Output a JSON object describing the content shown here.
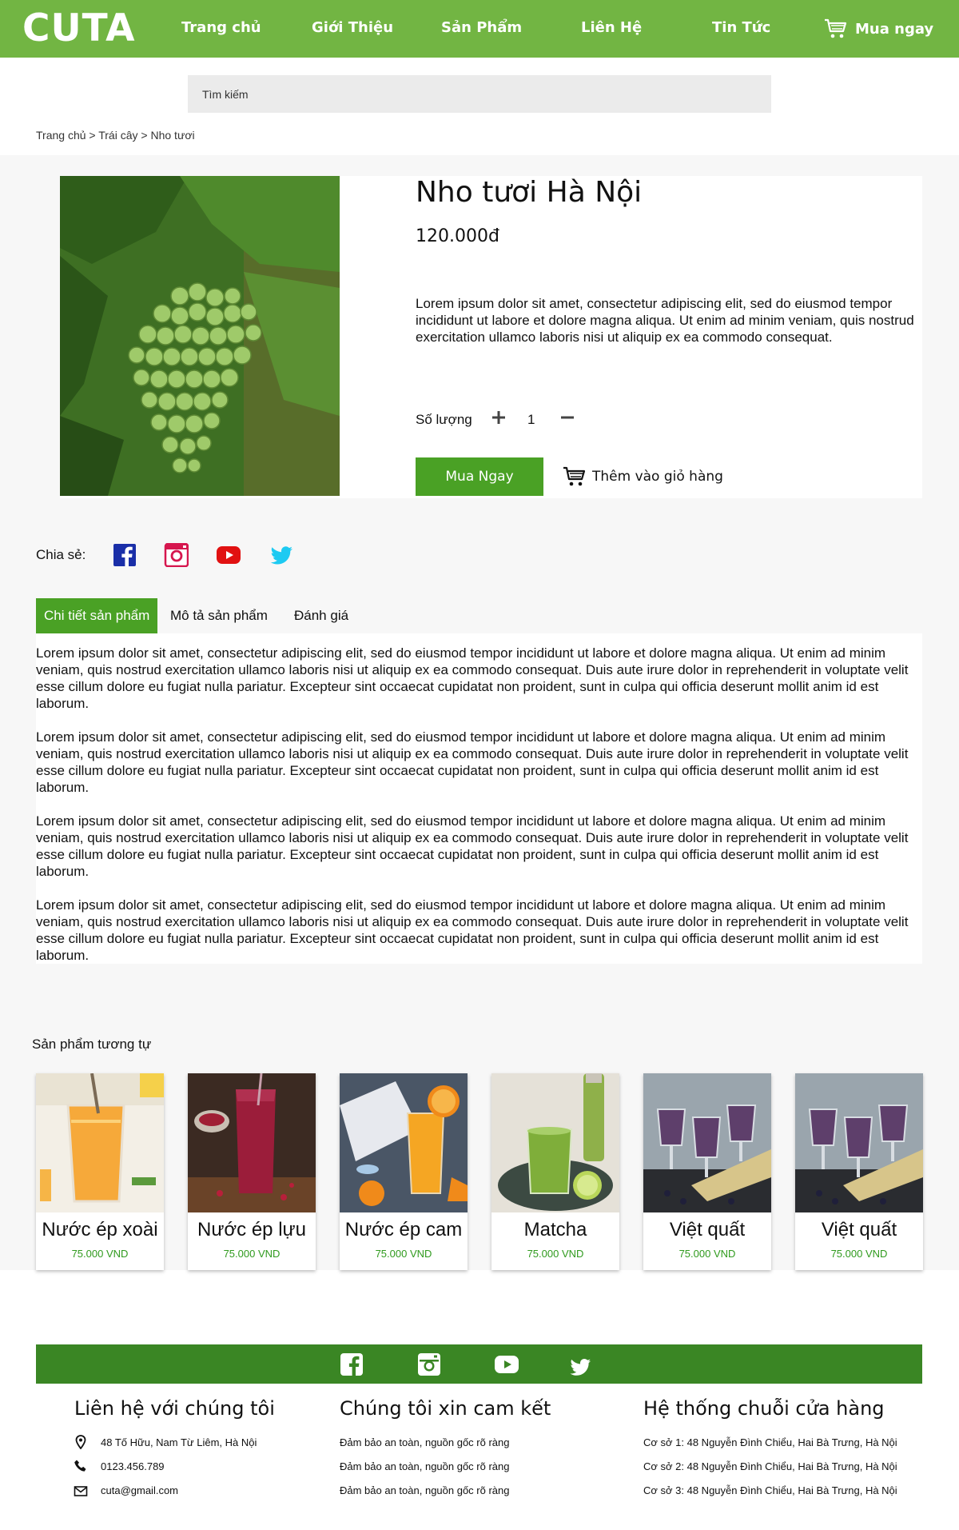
{
  "brand": {
    "logo": "CUTA",
    "primary_color": "#72b543",
    "button_color": "#4aa125",
    "footer_color": "#3a8624",
    "price_color": "#2f9a1d"
  },
  "nav": {
    "items": [
      "Trang chủ",
      "Giới Thiệu",
      "Sản Phẩm",
      "Liên Hệ",
      "Tin Tức"
    ],
    "cart_label": "Mua ngay",
    "cart_icon": "cart-icon"
  },
  "search": {
    "placeholder": "Tìm kiếm"
  },
  "breadcrumb": [
    "Trang chủ",
    "Trái cây",
    "Nho tươi"
  ],
  "product": {
    "title": "Nho tươi Hà Nội",
    "price": "120.000đ",
    "description": "Lorem ipsum dolor sit amet, consectetur adipiscing elit, sed do eiusmod tempor incididunt ut labore et dolore magna aliqua. Ut enim ad minim veniam, quis nostrud exercitation ullamco laboris nisi ut aliquip ex ea commodo consequat.",
    "quantity_label": "Số lượng",
    "quantity": "1",
    "buy_label": "Mua Ngay",
    "add_to_cart_label": "Thêm vào giỏ hàng"
  },
  "share": {
    "label": "Chia sẻ:",
    "icons": [
      "facebook-icon",
      "instagram-icon",
      "youtube-icon",
      "twitter-icon"
    ]
  },
  "tabs": {
    "items": [
      "Chi tiết sản phẩm",
      "Mô tả sản phẩm",
      "Đánh giá"
    ],
    "active": 0,
    "paragraphs": [
      "Lorem ipsum dolor sit amet, consectetur adipiscing elit, sed do eiusmod tempor incididunt ut labore et dolore magna aliqua. Ut enim ad minim veniam, quis nostrud exercitation ullamco laboris nisi ut aliquip ex ea commodo consequat. Duis aute irure dolor in reprehenderit in voluptate velit esse cillum dolore eu fugiat nulla pariatur. Excepteur sint occaecat cupidatat non proident, sunt in culpa qui officia deserunt mollit anim id est laborum.",
      "Lorem ipsum dolor sit amet, consectetur adipiscing elit, sed do eiusmod tempor incididunt ut labore et dolore magna aliqua. Ut enim ad minim veniam, quis nostrud exercitation ullamco laboris nisi ut aliquip ex ea commodo consequat. Duis aute irure dolor in reprehenderit in voluptate velit esse cillum dolore eu fugiat nulla pariatur. Excepteur sint occaecat cupidatat non proident, sunt in culpa qui officia deserunt mollit anim id est laborum.",
      "Lorem ipsum dolor sit amet, consectetur adipiscing elit, sed do eiusmod tempor incididunt ut labore et dolore magna aliqua. Ut enim ad minim veniam, quis nostrud exercitation ullamco laboris nisi ut aliquip ex ea commodo consequat. Duis aute irure dolor in reprehenderit in voluptate velit esse cillum dolore eu fugiat nulla pariatur. Excepteur sint occaecat cupidatat non proident, sunt in culpa qui officia deserunt mollit anim id est laborum.",
      "Lorem ipsum dolor sit amet, consectetur adipiscing elit, sed do eiusmod tempor incididunt ut labore et dolore magna aliqua. Ut enim ad minim veniam, quis nostrud exercitation ullamco laboris nisi ut aliquip ex ea commodo consequat. Duis aute irure dolor in reprehenderit in voluptate velit esse cillum dolore eu fugiat nulla pariatur. Excepteur sint occaecat cupidatat non proident, sunt in culpa qui officia deserunt mollit anim id est laborum."
    ]
  },
  "similar": {
    "title": "Sản phẩm tương tự",
    "items": [
      {
        "name": "Nước ép xoài",
        "price": "75.000 VND",
        "color": "#f2a73b"
      },
      {
        "name": "Nước ép lựu",
        "price": "75.000 VND",
        "color": "#9b1d3a"
      },
      {
        "name": "Nước ép cam",
        "price": "75.000 VND",
        "color": "#f5a623"
      },
      {
        "name": "Matcha",
        "price": "75.000 VND",
        "color": "#7fae3a"
      },
      {
        "name": "Việt quất",
        "price": "75.000 VND",
        "color": "#5e3f6b"
      },
      {
        "name": "Việt quất",
        "price": "75.000 VND",
        "color": "#5e3f6b"
      }
    ]
  },
  "footer": {
    "social_icons": [
      "facebook-icon",
      "instagram-icon",
      "youtube-icon",
      "twitter-icon"
    ],
    "contact": {
      "title": "Liên hệ với chúng tôi",
      "address": "48 Tố Hữu, Nam Từ Liêm, Hà Nội",
      "phone": "0123.456.789",
      "email": "cuta@gmail.com"
    },
    "commitment": {
      "title": "Chúng tôi xin cam kết",
      "lines": [
        "Đảm bảo an toàn, nguồn gốc rõ ràng",
        "Đảm bảo an toàn, nguồn gốc rõ ràng",
        "Đảm bảo an toàn, nguồn gốc rõ ràng"
      ]
    },
    "stores": {
      "title": "Hệ thống chuỗi cửa hàng",
      "lines": [
        "Cơ sở 1: 48 Nguyễn Đình Chiểu, Hai Bà Trưng, Hà Nội",
        "Cơ sở 2: 48 Nguyễn Đình Chiểu, Hai Bà Trưng, Hà Nội",
        "Cơ sở 3: 48 Nguyễn Đình Chiểu, Hai Bà Trưng, Hà Nội"
      ]
    }
  }
}
